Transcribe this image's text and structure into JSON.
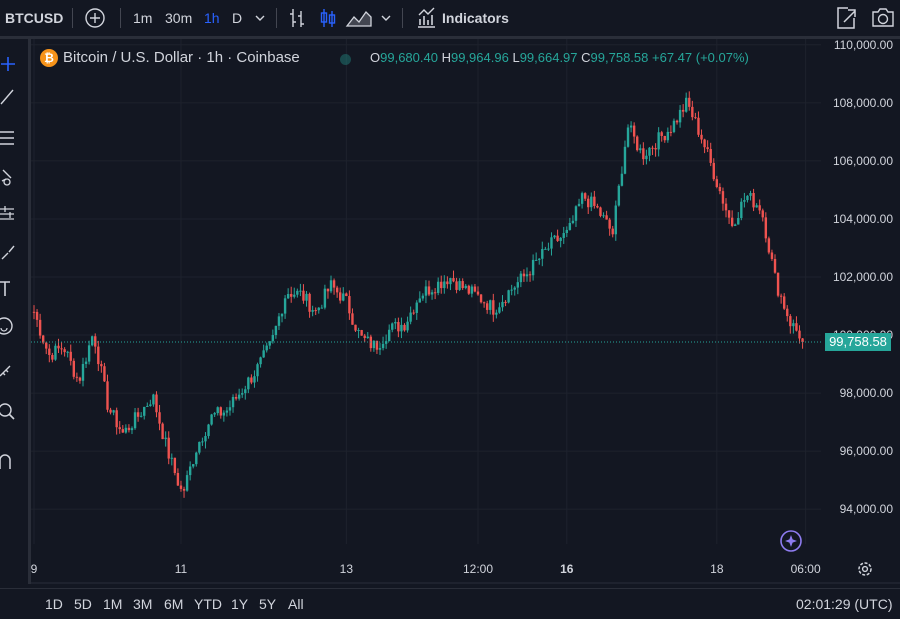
{
  "toolbar": {
    "symbol": "BTCUSD",
    "intervals": [
      "1m",
      "30m",
      "1h",
      "D"
    ],
    "active_interval": "1h",
    "indicators_label": "Indicators"
  },
  "legend": {
    "title": "Bitcoin / U.S. Dollar · 1h · Coinbase",
    "open_key": "O",
    "open": "99,680.40",
    "high_key": "H",
    "high": "99,964.96",
    "low_key": "L",
    "low": "99,664.97",
    "close_key": "C",
    "close": "99,758.58",
    "change": "+67.47 (+0.07%)"
  },
  "price_axis": {
    "current_price_label": "99,758.58"
  },
  "bottom": {
    "ranges": [
      "1D",
      "5D",
      "1M",
      "3M",
      "6M",
      "YTD",
      "1Y",
      "5Y",
      "All"
    ],
    "clock": "02:01:29 (UTC)"
  },
  "colors": {
    "up": "#26a69a",
    "down": "#ef5350",
    "background": "#131722",
    "accent": "#2962ff"
  },
  "chart_data": {
    "type": "candlestick",
    "title": "Bitcoin / U.S. Dollar · 1h · Coinbase",
    "x_tick_labels": [
      "9",
      "11",
      "13",
      "12:00",
      "16",
      "18",
      "06:00"
    ],
    "y_tick_labels": [
      "94,000.00",
      "96,000.00",
      "98,000.00",
      "100,000.00",
      "102,000.00",
      "104,000.00",
      "106,000.00",
      "108,000.00",
      "110,000.00"
    ],
    "ylim": [
      92800,
      110200
    ],
    "grid": true,
    "current_price": 99758.58,
    "approx_close_path": [
      {
        "t": "9",
        "v": 100800
      },
      {
        "t": "",
        "v": 99300
      },
      {
        "t": "",
        "v": 99600
      },
      {
        "t": "",
        "v": 98400
      },
      {
        "t": "",
        "v": 100100
      },
      {
        "t": "",
        "v": 97500
      },
      {
        "t": "",
        "v": 96600
      },
      {
        "t": "",
        "v": 97200
      },
      {
        "t": "",
        "v": 97900
      },
      {
        "t": "",
        "v": 96000
      },
      {
        "t": "11",
        "v": 94500
      },
      {
        "t": "",
        "v": 96200
      },
      {
        "t": "",
        "v": 97200
      },
      {
        "t": "",
        "v": 97400
      },
      {
        "t": "",
        "v": 98100
      },
      {
        "t": "",
        "v": 98800
      },
      {
        "t": "",
        "v": 99700
      },
      {
        "t": "",
        "v": 101500
      },
      {
        "t": "",
        "v": 101400
      },
      {
        "t": "",
        "v": 100800
      },
      {
        "t": "",
        "v": 101700
      },
      {
        "t": "13",
        "v": 101200
      },
      {
        "t": "",
        "v": 99900
      },
      {
        "t": "",
        "v": 99600
      },
      {
        "t": "",
        "v": 100200
      },
      {
        "t": "",
        "v": 100400
      },
      {
        "t": "",
        "v": 101400
      },
      {
        "t": "",
        "v": 101700
      },
      {
        "t": "",
        "v": 102000
      },
      {
        "t": "",
        "v": 101600
      },
      {
        "t": "12:00",
        "v": 101300
      },
      {
        "t": "",
        "v": 100900
      },
      {
        "t": "",
        "v": 101500
      },
      {
        "t": "",
        "v": 102000
      },
      {
        "t": "",
        "v": 102600
      },
      {
        "t": "",
        "v": 103200
      },
      {
        "t": "16",
        "v": 103500
      },
      {
        "t": "",
        "v": 104800
      },
      {
        "t": "",
        "v": 104300
      },
      {
        "t": "",
        "v": 103500
      },
      {
        "t": "",
        "v": 107200
      },
      {
        "t": "",
        "v": 106200
      },
      {
        "t": "",
        "v": 106700
      },
      {
        "t": "",
        "v": 107200
      },
      {
        "t": "",
        "v": 108000
      },
      {
        "t": "",
        "v": 106800
      },
      {
        "t": "18",
        "v": 105300
      },
      {
        "t": "",
        "v": 103800
      },
      {
        "t": "",
        "v": 104800
      },
      {
        "t": "",
        "v": 104400
      },
      {
        "t": "",
        "v": 101800
      },
      {
        "t": "",
        "v": 100400
      },
      {
        "t": "06:00",
        "v": 99758
      }
    ]
  }
}
